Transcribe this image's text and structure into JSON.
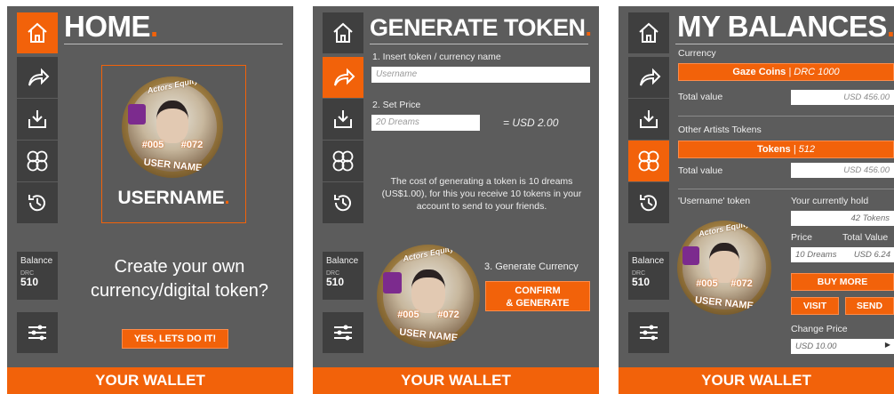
{
  "colors": {
    "accent": "#f2620a",
    "panel": "#5c5c5c",
    "sidebar": "#3f3f3f"
  },
  "sidebar": {
    "balance_label": "Balance",
    "currency_code": "DRC",
    "balance_value": "510",
    "icons": [
      "home-icon",
      "share-icon",
      "download-icon",
      "tokens-icon",
      "history-icon",
      "settings-icon"
    ]
  },
  "footer": {
    "label": "YOUR WALLET"
  },
  "badge": {
    "brand": "Actors Equity",
    "stat_a": "#005",
    "stat_b": "#072",
    "user": "USER NAME"
  },
  "home": {
    "title": "HOME",
    "title_dot": ".",
    "username": "USERNAME",
    "username_dot": ".",
    "prompt": "Create your own currency/digital token?",
    "cta": "YES, LETS DO IT!"
  },
  "generate": {
    "title": "GENERATE TOKEN",
    "title_dot": ".",
    "step1": "1. Insert token / currency name",
    "name_placeholder": "Username",
    "step2": "2. Set Price",
    "price_placeholder": "20 Dreams",
    "price_equiv": "= USD 2.00",
    "info": "The cost of generating a token is 10 dreams (US$1.00), for this you receive 10 tokens in your account to send to your friends.",
    "step3": "3. Generate Currency",
    "confirm_line1": "CONFIRM",
    "confirm_line2": "& GENERATE"
  },
  "balances": {
    "title": "MY BALANCES",
    "title_dot": ".",
    "currency_label": "Currency",
    "currency_name": "Gaze Coins",
    "currency_sub": "| DRC 1000",
    "total_value_label": "Total value",
    "total_value_1": "USD 456.00",
    "other_label": "Other Artists Tokens",
    "tokens_name": "Tokens",
    "tokens_sub": "| 512",
    "total_value_2": "USD 456.00",
    "username_token_label": "'Username' token",
    "currently_hold_label": "Your currently hold",
    "currently_hold_value": "42 Tokens",
    "price_label": "Price",
    "total_label": "Total Value",
    "price_value": "10 Dreams",
    "total_value_3": "USD 6.24",
    "buy_more": "BUY MORE",
    "visit": "VISIT",
    "send": "SEND",
    "change_price_label": "Change Price",
    "change_price_value": "USD 10.00"
  }
}
